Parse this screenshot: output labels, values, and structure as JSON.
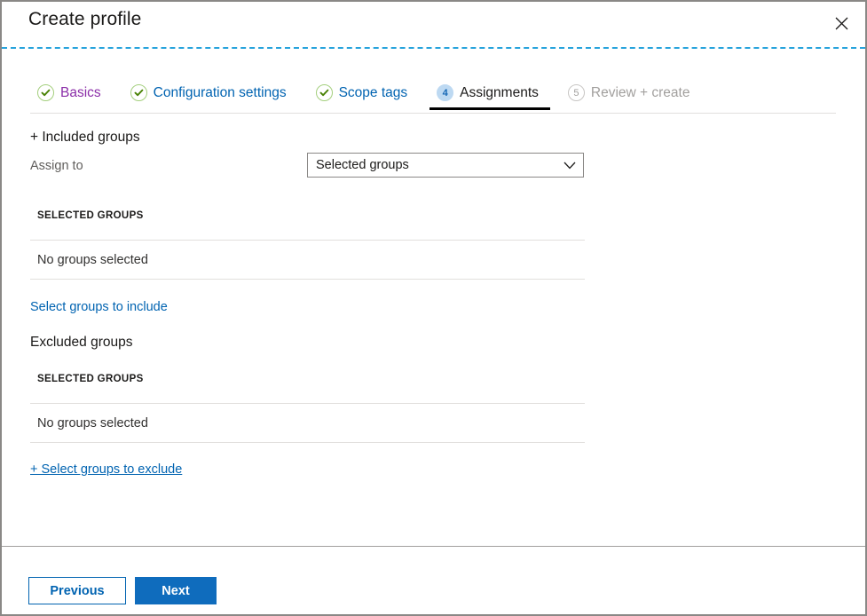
{
  "window": {
    "title": "Create profile",
    "close_icon": "close-icon"
  },
  "wizard": {
    "tabs": [
      {
        "badge": "✓",
        "label": "Basics",
        "state": "done"
      },
      {
        "badge": "✓",
        "label": "Configuration settings",
        "state": "done"
      },
      {
        "badge": "✓",
        "label": "Scope tags",
        "state": "done"
      },
      {
        "badge": "4",
        "label": "Assignments",
        "state": "current"
      },
      {
        "badge": "5",
        "label": "Review + create",
        "state": "pending"
      }
    ]
  },
  "main": {
    "included": {
      "heading": "+ Included groups",
      "assign_to_label": "Assign to",
      "assign_to_value": "Selected groups",
      "assign_to_options": [
        "Selected groups"
      ],
      "list_header": "SELECTED GROUPS",
      "empty_text": "No groups selected",
      "link": "Select groups to include"
    },
    "excluded": {
      "heading": "Excluded groups",
      "list_header": "SELECTED GROUPS",
      "empty_text": "No groups selected",
      "link": "+ Select groups to exclude"
    }
  },
  "footer": {
    "previous_label": "Previous",
    "next_label": "Next"
  },
  "colors": {
    "accent_blue": "#0063b1",
    "primary_button": "#0f6cbd",
    "visited_link": "#8b2ea8",
    "check_green": "#498205",
    "dashed_rule": "#27a3dc",
    "disabled_gray": "#a19f9d"
  }
}
